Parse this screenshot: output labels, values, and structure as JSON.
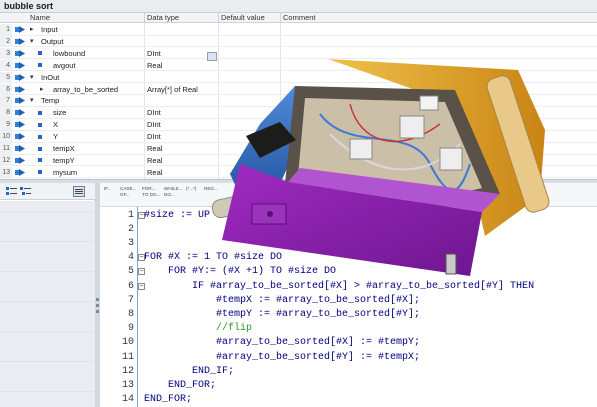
{
  "title": "bubble sort",
  "table": {
    "headers": {
      "name": "Name",
      "datatype": "Data type",
      "default": "Default value",
      "comment": "Comment"
    },
    "rows": [
      {
        "num": "1",
        "toggle": "▸",
        "name": "Input",
        "dtype": "",
        "level": 0,
        "section": true
      },
      {
        "num": "2",
        "toggle": "▾",
        "name": "Output",
        "dtype": "",
        "level": 0,
        "section": true
      },
      {
        "num": "3",
        "toggle": "",
        "name": "lowbound",
        "dtype": "DInt",
        "level": 1,
        "section": false
      },
      {
        "num": "4",
        "toggle": "",
        "name": "avgout",
        "dtype": "Real",
        "level": 1,
        "section": false
      },
      {
        "num": "5",
        "toggle": "▾",
        "name": "InOut",
        "dtype": "",
        "level": 0,
        "section": true
      },
      {
        "num": "6",
        "toggle": "▸",
        "name": "array_to_be_sorted",
        "dtype": "Array[*] of Real",
        "level": 1,
        "section": false
      },
      {
        "num": "7",
        "toggle": "▾",
        "name": "Temp",
        "dtype": "",
        "level": 0,
        "section": true
      },
      {
        "num": "8",
        "toggle": "",
        "name": "size",
        "dtype": "DInt",
        "level": 1,
        "section": false
      },
      {
        "num": "9",
        "toggle": "",
        "name": "X",
        "dtype": "DInt",
        "level": 1,
        "section": false
      },
      {
        "num": "10",
        "toggle": "",
        "name": "Y",
        "dtype": "DInt",
        "level": 1,
        "section": false
      },
      {
        "num": "11",
        "toggle": "",
        "name": "tempX",
        "dtype": "Real",
        "level": 1,
        "section": false
      },
      {
        "num": "12",
        "toggle": "",
        "name": "tempY",
        "dtype": "Real",
        "level": 1,
        "section": false
      },
      {
        "num": "13",
        "toggle": "",
        "name": "mysum",
        "dtype": "Real",
        "level": 1,
        "section": false
      }
    ]
  },
  "keywords": [
    {
      "a": "IF...",
      "b": ""
    },
    {
      "a": "CASE...",
      "b": "OF..."
    },
    {
      "a": "FOR...",
      "b": "TO DO..."
    },
    {
      "a": "WHILE...",
      "b": "DO..."
    },
    {
      "a": "(*...*)",
      "b": ""
    },
    {
      "a": "REG...",
      "b": ""
    }
  ],
  "code": [
    {
      "n": "1",
      "text": "#size := UP"
    },
    {
      "n": "2",
      "text": ""
    },
    {
      "n": "3",
      "text": ""
    },
    {
      "n": "4",
      "text": "FOR #X := 1 TO #size DO"
    },
    {
      "n": "5",
      "text": "    FOR #Y:= (#X +1) TO #size DO"
    },
    {
      "n": "6",
      "text": "        IF #array_to_be_sorted[#X] > #array_to_be_sorted[#Y] THEN"
    },
    {
      "n": "7",
      "text": "            #tempX := #array_to_be_sorted[#X];"
    },
    {
      "n": "8",
      "text": "            #tempY := #array_to_be_sorted[#Y];"
    },
    {
      "n": "9",
      "text": "            //flip"
    },
    {
      "n": "10",
      "text": "            #array_to_be_sorted[#X] := #tempY;"
    },
    {
      "n": "11",
      "text": "            #array_to_be_sorted[#Y] := #tempX;"
    },
    {
      "n": "12",
      "text": "        END_IF;"
    },
    {
      "n": "13",
      "text": "    END_FOR;"
    },
    {
      "n": "14",
      "text": "END_FOR;"
    }
  ],
  "colors": {
    "code_keyword": "#000080",
    "comment": "#2a9a2a",
    "var_icon": "#2566c6",
    "photo_purple": "#8a1fa8",
    "photo_yellow": "#e2a21a",
    "photo_blue": "#2f6fc4"
  }
}
